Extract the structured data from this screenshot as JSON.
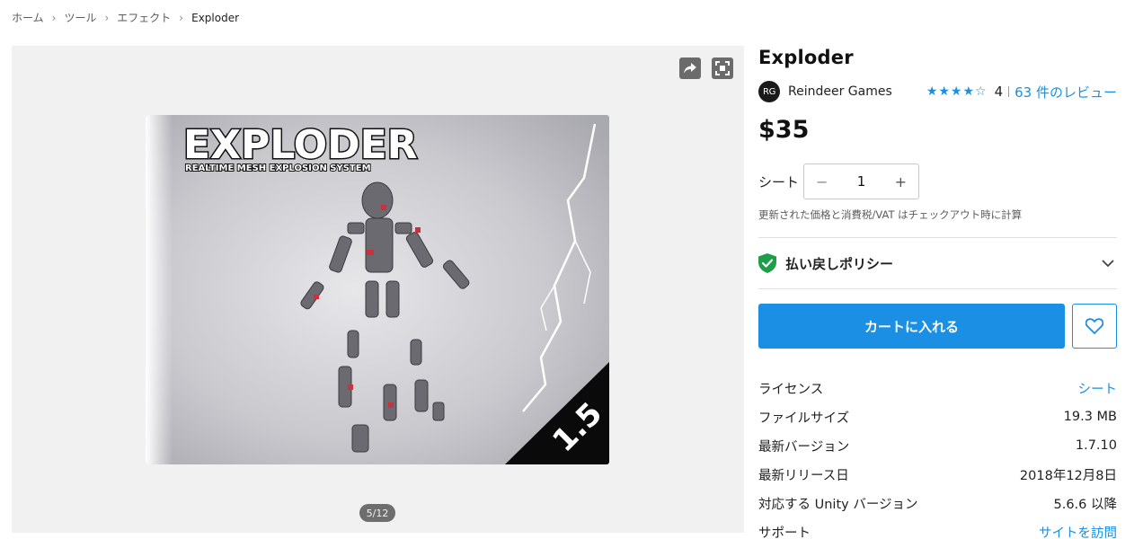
{
  "breadcrumb": {
    "items": [
      "ホーム",
      "ツール",
      "エフェクト",
      "Exploder"
    ]
  },
  "gallery": {
    "counter": "5/12",
    "image": {
      "title": "EXPLODER",
      "subtitle": "REALTIME MESH EXPLOSION SYSTEM",
      "version_badge": "1.5"
    }
  },
  "product": {
    "title": "Exploder",
    "publisher_initials": "RG",
    "publisher_name": "Reindeer Games",
    "stars": 4,
    "stars_display": "★★★★☆",
    "rating_number": "4",
    "reviews_link": "63 件のレビュー",
    "price": "$35",
    "seat_label": "シート",
    "quantity": "1",
    "minus": "−",
    "plus": "+",
    "tax_note": "更新された価格と消費税/VAT はチェックアウト時に計算",
    "policy_label": "払い戻しポリシー",
    "cart_button": "カートに入れる"
  },
  "details": [
    {
      "key": "ライセンス",
      "value": "シート",
      "link": true
    },
    {
      "key": "ファイルサイズ",
      "value": "19.3 MB",
      "link": false
    },
    {
      "key": "最新バージョン",
      "value": "1.7.10",
      "link": false
    },
    {
      "key": "最新リリース日",
      "value": "2018年12月8日",
      "link": false
    },
    {
      "key": "対応する Unity バージョン",
      "value": "5.6.6 以降",
      "link": false
    },
    {
      "key": "サポート",
      "value": "サイトを訪問",
      "link": true
    }
  ],
  "colors": {
    "accent": "#1a8fe3",
    "shield": "#1e9e4a",
    "gallery_bg": "#f1f1f1"
  }
}
